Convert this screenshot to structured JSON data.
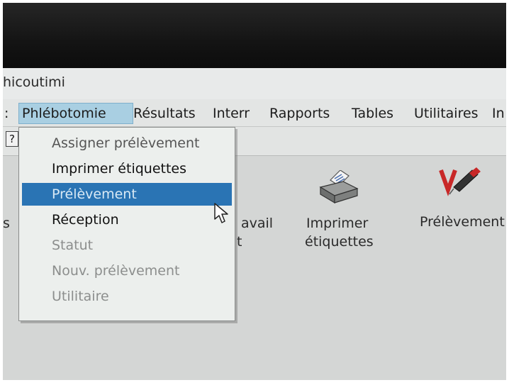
{
  "window": {
    "title": "hicoutimi"
  },
  "menubar": {
    "left_fragment": ":",
    "items": [
      {
        "label": "Phlébotomie",
        "active": true
      },
      {
        "label": "Résultats"
      },
      {
        "label": "Interr"
      },
      {
        "label": "Rapports"
      },
      {
        "label": "Tables"
      },
      {
        "label": "Utilitaires"
      },
      {
        "label": "In"
      }
    ]
  },
  "toolbar": {
    "help_label": "?"
  },
  "dropdown": {
    "items": [
      {
        "label": "Assigner prélèvement",
        "state": "dim"
      },
      {
        "label": "Imprimer étiquettes",
        "state": "enabled"
      },
      {
        "label": "Prélèvement",
        "state": "highlighted"
      },
      {
        "label": "Réception",
        "state": "enabled"
      },
      {
        "label": "Statut",
        "state": "disabled"
      },
      {
        "label": "Nouv. prélèvement",
        "state": "disabled"
      },
      {
        "label": "Utilitaire",
        "state": "disabled"
      }
    ]
  },
  "tiles": {
    "left_fragment": "s",
    "partial_line1": "avail",
    "partial_line2": "t",
    "print_labels_line1": "Imprimer",
    "print_labels_line2": "étiquettes",
    "collection": "Prélèvement"
  },
  "icons": {
    "printer": "printer-icon",
    "collection": "blood-collection-icon",
    "cursor": "mouse-pointer-icon"
  },
  "colors": {
    "highlight": "#2a74b4",
    "menu_active": "#a9cfe2",
    "collection_icon_red": "#c82828"
  }
}
